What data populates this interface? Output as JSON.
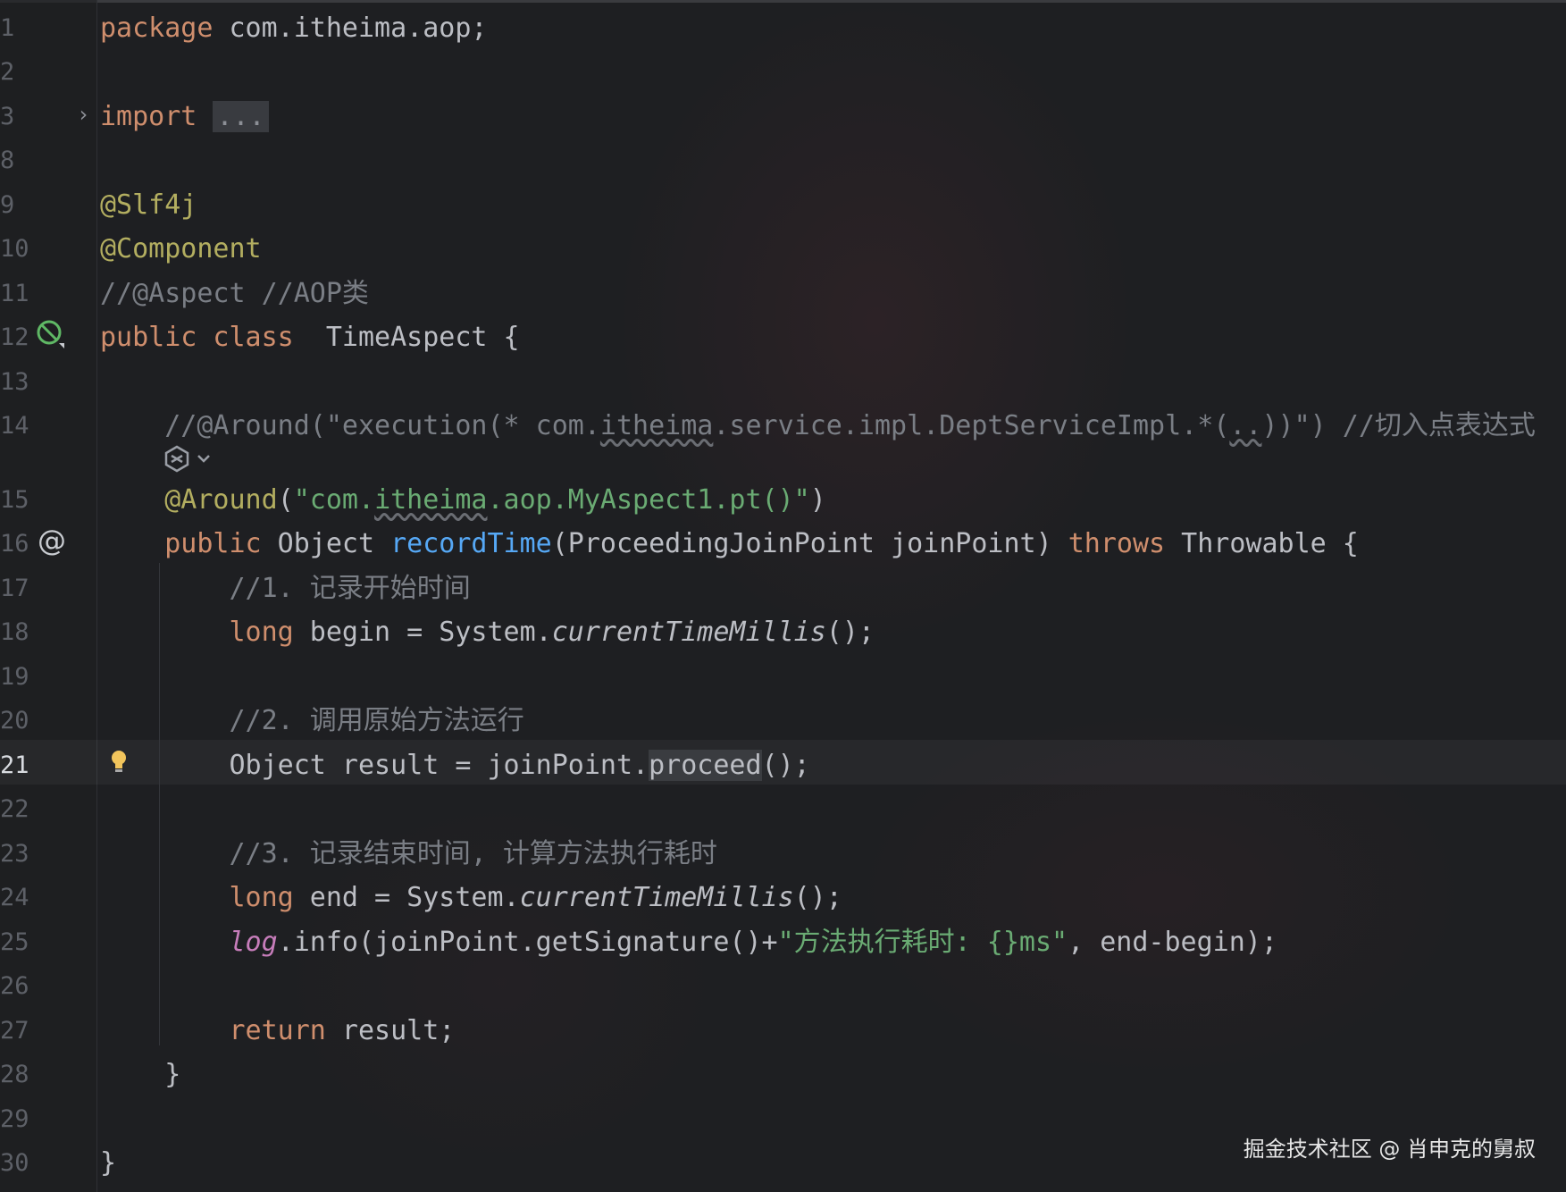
{
  "editor": {
    "current_line": 21,
    "colors": {
      "background": "#1e1f22",
      "keyword": "#cf8e6d",
      "annotation": "#b3ae60",
      "comment": "#7a7e85",
      "string": "#6aab73",
      "method_decl": "#56a8f5",
      "field": "#c77dbb",
      "text": "#bcbec4"
    },
    "lines": [
      {
        "n": "1",
        "tokens": [
          {
            "t": "package",
            "c": "kw"
          },
          {
            "t": " com.itheima.aop;"
          }
        ]
      },
      {
        "n": "2",
        "tokens": []
      },
      {
        "n": "3",
        "tokens": [
          {
            "t": "import",
            "c": "kw"
          },
          {
            "t": " "
          },
          {
            "t": "...",
            "c": "fold-box"
          }
        ]
      },
      {
        "n": "8",
        "tokens": []
      },
      {
        "n": "9",
        "tokens": [
          {
            "t": "@Slf4j",
            "c": "ann"
          }
        ]
      },
      {
        "n": "10",
        "tokens": [
          {
            "t": "@Component",
            "c": "ann"
          }
        ]
      },
      {
        "n": "11",
        "tokens": [
          {
            "t": "//@Aspect //AOP类",
            "c": "cm"
          }
        ]
      },
      {
        "n": "12",
        "tokens": [
          {
            "t": "public class",
            "c": "kw"
          },
          {
            "t": "  TimeAspect {"
          }
        ]
      },
      {
        "n": "13",
        "tokens": []
      },
      {
        "n": "14",
        "tokens": [
          {
            "t": "    //@Around(\"execution(* com.",
            "c": "cm"
          },
          {
            "t": "itheima",
            "c": "cm wavy"
          },
          {
            "t": ".service.impl.DeptServiceImpl.*(",
            "c": "cm"
          },
          {
            "t": "..",
            "c": "cm wavy"
          },
          {
            "t": "))\") //切入点表达式",
            "c": "cm"
          }
        ]
      },
      {
        "n": "15",
        "tokens": [
          {
            "t": "    "
          },
          {
            "t": "@Around",
            "c": "ann"
          },
          {
            "t": "("
          },
          {
            "t": "\"com.",
            "c": "str"
          },
          {
            "t": "itheima",
            "c": "str wavy"
          },
          {
            "t": ".aop.MyAspect1.pt()\"",
            "c": "str"
          },
          {
            "t": ")"
          }
        ]
      },
      {
        "n": "16",
        "tokens": [
          {
            "t": "    "
          },
          {
            "t": "public",
            "c": "kw"
          },
          {
            "t": " Object "
          },
          {
            "t": "recordTime",
            "c": "fn"
          },
          {
            "t": "(ProceedingJoinPoint joinPoint) "
          },
          {
            "t": "throws",
            "c": "kw"
          },
          {
            "t": " Throwable {"
          }
        ]
      },
      {
        "n": "17",
        "tokens": [
          {
            "t": "        //1. 记录开始时间",
            "c": "cm"
          }
        ]
      },
      {
        "n": "18",
        "tokens": [
          {
            "t": "        "
          },
          {
            "t": "long",
            "c": "kw"
          },
          {
            "t": " begin = System."
          },
          {
            "t": "currentTimeMillis",
            "c": "it"
          },
          {
            "t": "();"
          }
        ]
      },
      {
        "n": "19",
        "tokens": []
      },
      {
        "n": "20",
        "tokens": [
          {
            "t": "        //2. 调用原始方法运行",
            "c": "cm"
          }
        ]
      },
      {
        "n": "21",
        "tokens": [
          {
            "t": "        Object result = joinPoint."
          },
          {
            "t": "proceed",
            "c": "hl-word"
          },
          {
            "t": "();"
          }
        ]
      },
      {
        "n": "22",
        "tokens": []
      },
      {
        "n": "23",
        "tokens": [
          {
            "t": "        //3. 记录结束时间, 计算方法执行耗时",
            "c": "cm"
          }
        ]
      },
      {
        "n": "24",
        "tokens": [
          {
            "t": "        "
          },
          {
            "t": "long",
            "c": "kw"
          },
          {
            "t": " end = System."
          },
          {
            "t": "currentTimeMillis",
            "c": "it"
          },
          {
            "t": "();"
          }
        ]
      },
      {
        "n": "25",
        "tokens": [
          {
            "t": "        "
          },
          {
            "t": "log",
            "c": "fld"
          },
          {
            "t": ".info(joinPoint.getSignature()+"
          },
          {
            "t": "\"方法执行耗时: {}ms\"",
            "c": "str"
          },
          {
            "t": ", end-begin);"
          }
        ]
      },
      {
        "n": "26",
        "tokens": []
      },
      {
        "n": "27",
        "tokens": [
          {
            "t": "        "
          },
          {
            "t": "return",
            "c": "kw"
          },
          {
            "t": " result;"
          }
        ]
      },
      {
        "n": "28",
        "tokens": [
          {
            "t": "    }"
          }
        ]
      },
      {
        "n": "29",
        "tokens": []
      },
      {
        "n": "30",
        "tokens": [
          {
            "t": "}"
          }
        ]
      }
    ],
    "gutter_icons": {
      "fold": "chevron-right-icon",
      "bean": "spring-bean-icon",
      "override": "at-sign-icon",
      "intention": "lightbulb-icon",
      "ai_assist": "ai-assistant-icon"
    },
    "ai_icon_glyph": "⌄",
    "override_glyph": "@",
    "fold_glyph": "›"
  },
  "watermark": "掘金技术社区 @ 肖申克的舅叔"
}
